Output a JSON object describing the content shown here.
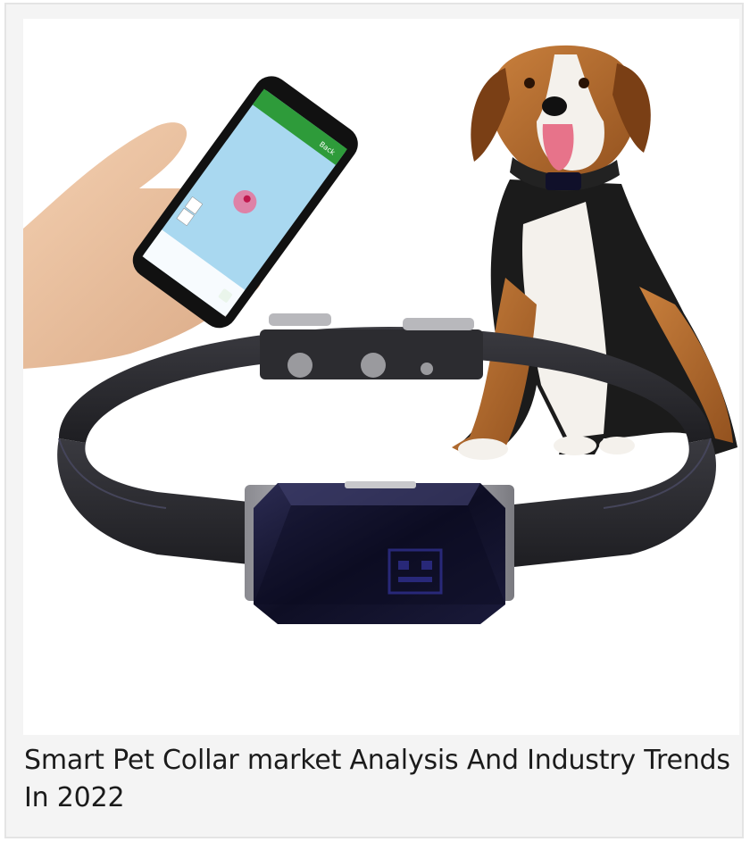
{
  "article": {
    "title": "Smart Pet Collar market Analysis And Industry Trends In 2022",
    "image_alt": "Smart pet GPS collar with smartphone tracking app and beagle dog"
  },
  "phone_app": {
    "header_label": "Back",
    "app_color": "#2e9b3a",
    "map_color": "#a9d8f0"
  },
  "colors": {
    "collar_leather": "#2a2a2e",
    "tracker_body": "#14142a",
    "dog_tan": "#b56a2c"
  }
}
